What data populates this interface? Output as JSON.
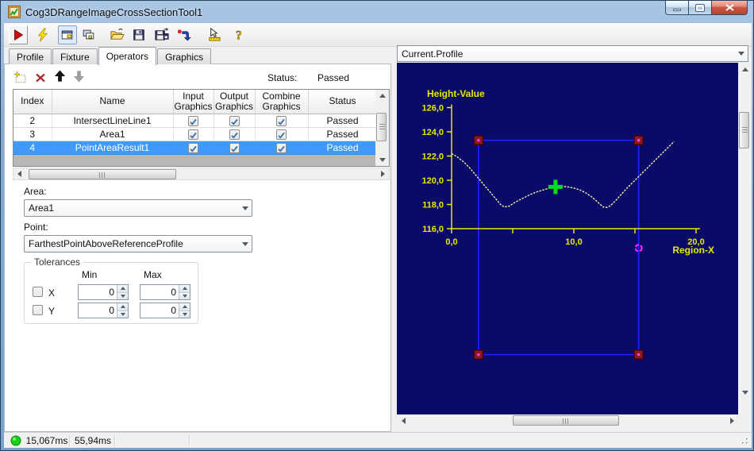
{
  "window": {
    "title": "Cog3DRangeImageCrossSectionTool1"
  },
  "toolbar": {
    "icons": [
      "run",
      "electric",
      "show-image-window",
      "cascade-windows",
      "open-file",
      "save",
      "save-as",
      "reset",
      "measure",
      "help"
    ]
  },
  "tabs": {
    "items": [
      "Profile",
      "Fixture",
      "Operators",
      "Graphics"
    ],
    "active": "Operators"
  },
  "operator_bar": {
    "icons": [
      "new-operator",
      "delete-operator",
      "move-up",
      "move-down"
    ],
    "status_label": "Status:",
    "status_value": "Passed"
  },
  "operators_table": {
    "columns": [
      "Index",
      "Name",
      "Input Graphics",
      "Output Graphics",
      "Combine Graphics",
      "Status"
    ],
    "rows": [
      {
        "index": "2",
        "name": "IntersectLineLine1",
        "input_graphics": true,
        "output_graphics": true,
        "combine_graphics": true,
        "status": "Passed",
        "selected": false
      },
      {
        "index": "3",
        "name": "Area1",
        "input_graphics": true,
        "output_graphics": true,
        "combine_graphics": true,
        "status": "Passed",
        "selected": false
      },
      {
        "index": "4",
        "name": "PointAreaResult1",
        "input_graphics": true,
        "output_graphics": true,
        "combine_graphics": true,
        "status": "Passed",
        "selected": true
      }
    ]
  },
  "area_combo": {
    "label": "Area:",
    "value": "Area1"
  },
  "point_combo": {
    "label": "Point:",
    "value": "FarthestPointAboveReferenceProfile"
  },
  "tolerances": {
    "legend": "Tolerances",
    "min_header": "Min",
    "max_header": "Max",
    "rows": [
      {
        "label": "X",
        "checked": false,
        "min": "0",
        "max": "0"
      },
      {
        "label": "Y",
        "checked": false,
        "min": "0",
        "max": "0"
      }
    ]
  },
  "profile_panel": {
    "selector_value": "Current.Profile"
  },
  "status_bar": {
    "run_time": "15,067ms",
    "total_time": "55,94ms"
  },
  "chart_data": {
    "type": "line",
    "title": "",
    "xlabel": "Region-X",
    "ylabel": "Height-Value",
    "xlim": [
      0,
      20
    ],
    "ylim": [
      116,
      126
    ],
    "x_ticks": [
      {
        "v": 0,
        "label": "0,0"
      },
      {
        "v": 5,
        "label": ""
      },
      {
        "v": 10,
        "label": "10,0"
      },
      {
        "v": 15,
        "label": ""
      },
      {
        "v": 20,
        "label": "20,0"
      }
    ],
    "y_ticks": [
      {
        "v": 116,
        "label": "116,0"
      },
      {
        "v": 118,
        "label": "118,0"
      },
      {
        "v": 120,
        "label": "120,0"
      },
      {
        "v": 122,
        "label": "122,0"
      },
      {
        "v": 124,
        "label": "124,0"
      },
      {
        "v": 126,
        "label": "126,0"
      }
    ],
    "colors": {
      "background": "#0a0a68",
      "axis": "#e8e800",
      "curve": "#ffffa8",
      "region": "#2222ff",
      "corner_fill": "#8c1a1e",
      "corner_border": "#4d000a",
      "corner_center": "#ff42ff",
      "cross": "#00dd1c",
      "ring": "#ff22ff"
    },
    "series": [
      {
        "name": "profile",
        "points": [
          [
            0,
            122.2
          ],
          [
            0.5,
            121.9
          ],
          [
            1.0,
            121.5
          ],
          [
            1.5,
            121.0
          ],
          [
            2.0,
            120.4
          ],
          [
            2.5,
            119.8
          ],
          [
            3.0,
            119.2
          ],
          [
            3.5,
            118.6
          ],
          [
            4.0,
            118.0
          ],
          [
            4.3,
            117.8
          ],
          [
            4.7,
            117.85
          ],
          [
            5.0,
            118.05
          ],
          [
            5.5,
            118.35
          ],
          [
            6.0,
            118.6
          ],
          [
            6.5,
            118.85
          ],
          [
            7.0,
            119.05
          ],
          [
            7.5,
            119.2
          ],
          [
            8.0,
            119.35
          ],
          [
            8.5,
            119.45
          ],
          [
            9.0,
            119.5
          ],
          [
            9.5,
            119.45
          ],
          [
            10.0,
            119.35
          ],
          [
            10.5,
            119.2
          ],
          [
            11.0,
            118.95
          ],
          [
            11.5,
            118.6
          ],
          [
            12.0,
            118.15
          ],
          [
            12.4,
            117.8
          ],
          [
            12.7,
            117.75
          ],
          [
            13.0,
            117.9
          ],
          [
            13.4,
            118.3
          ],
          [
            13.9,
            118.85
          ],
          [
            14.4,
            119.4
          ],
          [
            14.9,
            119.9
          ],
          [
            15.4,
            120.4
          ],
          [
            15.9,
            120.9
          ],
          [
            16.4,
            121.4
          ],
          [
            16.9,
            121.9
          ],
          [
            17.4,
            122.4
          ],
          [
            17.9,
            122.9
          ],
          [
            18.2,
            123.2
          ]
        ]
      }
    ],
    "region_rect": {
      "x1": 2.2,
      "x2": 15.3,
      "y_top": 123.3,
      "y_bottom": 105.6
    },
    "markers": [
      {
        "name": "farthest-point-marker",
        "shape": "cross",
        "x": 8.5,
        "y": 119.45
      },
      {
        "name": "intersection-marker",
        "shape": "ring",
        "x": 15.3,
        "y": 114.4
      }
    ]
  }
}
